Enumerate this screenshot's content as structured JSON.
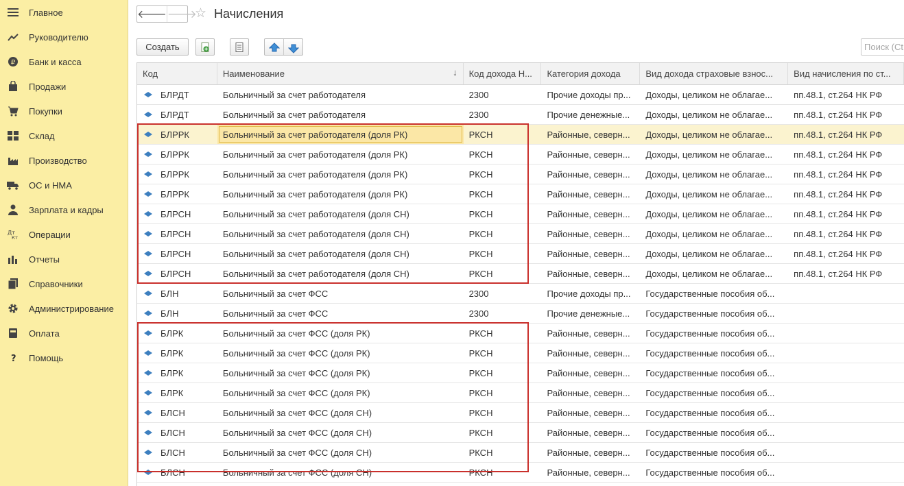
{
  "sidebar": {
    "items": [
      {
        "label": "Главное",
        "icon": "hamburger-menu-icon"
      },
      {
        "label": "Руководителю",
        "icon": "trend-chart-icon"
      },
      {
        "label": "Банк и касса",
        "icon": "ruble-coin-icon"
      },
      {
        "label": "Продажи",
        "icon": "shopping-bag-icon"
      },
      {
        "label": "Покупки",
        "icon": "shopping-cart-icon"
      },
      {
        "label": "Склад",
        "icon": "warehouse-grid-icon"
      },
      {
        "label": "Производство",
        "icon": "factory-icon"
      },
      {
        "label": "ОС и НМА",
        "icon": "truck-icon"
      },
      {
        "label": "Зарплата и кадры",
        "icon": "person-icon"
      },
      {
        "label": "Операции",
        "icon": "debit-credit-icon"
      },
      {
        "label": "Отчеты",
        "icon": "bar-chart-icon"
      },
      {
        "label": "Справочники",
        "icon": "books-icon"
      },
      {
        "label": "Администрирование",
        "icon": "gear-icon"
      },
      {
        "label": "Оплата",
        "icon": "payment-icon"
      },
      {
        "label": "Помощь",
        "icon": "question-icon"
      }
    ]
  },
  "header": {
    "title": "Начисления",
    "back_icon": "arrow-left-icon",
    "forward_icon": "arrow-right-icon",
    "favorite_icon": "star-icon"
  },
  "toolbar": {
    "create_label": "Создать",
    "search_placeholder": "Поиск (Ct"
  },
  "table": {
    "columns": [
      "Код",
      "Наименование",
      "Код дохода Н...",
      "Категория дохода",
      "Вид дохода страховые взнос...",
      "Вид начисления по ст..."
    ],
    "sorted_column": "Наименование",
    "selected_row_index": 2,
    "rows": [
      [
        "БЛРДТ",
        "Больничный за счет работодателя",
        "2300",
        "Прочие доходы пр...",
        "Доходы, целиком не облагае...",
        "пп.48.1, ст.264 НК РФ"
      ],
      [
        "БЛРДТ",
        "Больничный за счет работодателя",
        "2300",
        "Прочие денежные...",
        "Доходы, целиком не облагае...",
        "пп.48.1, ст.264 НК РФ"
      ],
      [
        "БЛРРК",
        "Больничный за счет работодателя (доля РК)",
        "РКСН",
        "Районные, северн...",
        "Доходы, целиком не облагае...",
        "пп.48.1, ст.264 НК РФ"
      ],
      [
        "БЛРРК",
        "Больничный за счет работодателя (доля РК)",
        "РКСН",
        "Районные, северн...",
        "Доходы, целиком не облагае...",
        "пп.48.1, ст.264 НК РФ"
      ],
      [
        "БЛРРК",
        "Больничный за счет работодателя (доля РК)",
        "РКСН",
        "Районные, северн...",
        "Доходы, целиком не облагае...",
        "пп.48.1, ст.264 НК РФ"
      ],
      [
        "БЛРРК",
        "Больничный за счет работодателя (доля РК)",
        "РКСН",
        "Районные, северн...",
        "Доходы, целиком не облагае...",
        "пп.48.1, ст.264 НК РФ"
      ],
      [
        "БЛРСН",
        "Больничный за счет работодателя (доля СН)",
        "РКСН",
        "Районные, северн...",
        "Доходы, целиком не облагае...",
        "пп.48.1, ст.264 НК РФ"
      ],
      [
        "БЛРСН",
        "Больничный за счет работодателя (доля СН)",
        "РКСН",
        "Районные, северн...",
        "Доходы, целиком не облагае...",
        "пп.48.1, ст.264 НК РФ"
      ],
      [
        "БЛРСН",
        "Больничный за счет работодателя (доля СН)",
        "РКСН",
        "Районные, северн...",
        "Доходы, целиком не облагае...",
        "пп.48.1, ст.264 НК РФ"
      ],
      [
        "БЛРСН",
        "Больничный за счет работодателя (доля СН)",
        "РКСН",
        "Районные, северн...",
        "Доходы, целиком не облагае...",
        "пп.48.1, ст.264 НК РФ"
      ],
      [
        "БЛН",
        "Больничный за счет ФСС",
        "2300",
        "Прочие доходы пр...",
        "Государственные пособия об...",
        ""
      ],
      [
        "БЛН",
        "Больничный за счет ФСС",
        "2300",
        "Прочие денежные...",
        "Государственные пособия об...",
        ""
      ],
      [
        "БЛРК",
        "Больничный за счет ФСС (доля РК)",
        "РКСН",
        "Районные, северн...",
        "Государственные пособия об...",
        ""
      ],
      [
        "БЛРК",
        "Больничный за счет ФСС (доля РК)",
        "РКСН",
        "Районные, северн...",
        "Государственные пособия об...",
        ""
      ],
      [
        "БЛРК",
        "Больничный за счет ФСС (доля РК)",
        "РКСН",
        "Районные, северн...",
        "Государственные пособия об...",
        ""
      ],
      [
        "БЛРК",
        "Больничный за счет ФСС (доля РК)",
        "РКСН",
        "Районные, северн...",
        "Государственные пособия об...",
        ""
      ],
      [
        "БЛСН",
        "Больничный за счет ФСС (доля СН)",
        "РКСН",
        "Районные, северн...",
        "Государственные пособия об...",
        ""
      ],
      [
        "БЛСН",
        "Больничный за счет ФСС (доля СН)",
        "РКСН",
        "Районные, северн...",
        "Государственные пособия об...",
        ""
      ],
      [
        "БЛСН",
        "Больничный за счет ФСС (доля СН)",
        "РКСН",
        "Районные, северн...",
        "Государственные пособия об...",
        ""
      ],
      [
        "БЛСН",
        "Больничный за счет ФСС (доля СН)",
        "РКСН",
        "Районные, северн...",
        "Государственные пособия об...",
        ""
      ]
    ]
  },
  "colors": {
    "sidebar_bg": "#fbeea4",
    "highlight_box": "#c9302c",
    "selected_row": "#fbf3cf",
    "row_marker": "#3d7fbf"
  }
}
